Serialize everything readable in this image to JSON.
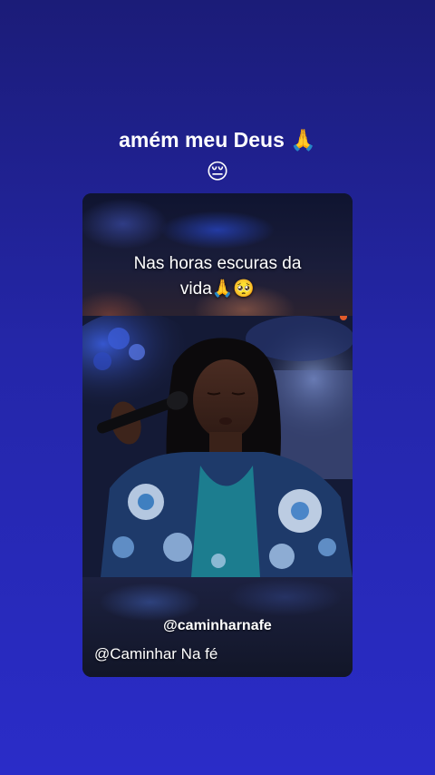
{
  "post": {
    "caption_line1": "amém meu Deus 🙏",
    "caption_line2": "😔"
  },
  "video": {
    "overlay_line1": "Nas horas escuras da",
    "overlay_line2": "vida🙏🥺",
    "watermark_handle": "@caminharnafe",
    "channel_name": "@Caminhar Na fé"
  },
  "colors": {
    "background_top": "#1b1c78",
    "background_bottom": "#2a2cc8",
    "text": "#ffffff"
  }
}
